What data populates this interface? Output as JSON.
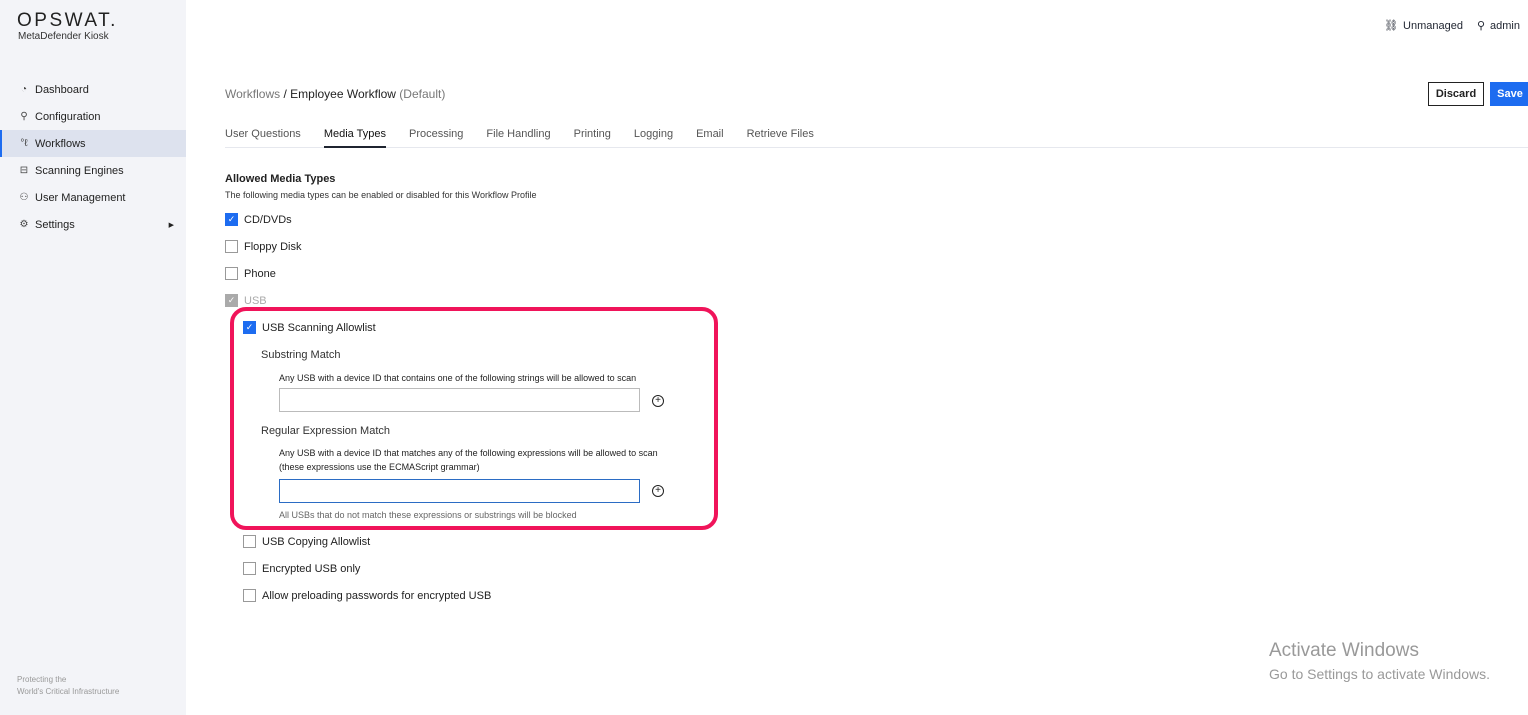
{
  "brand": {
    "logo": "OPSWAT.",
    "product": "MetaDefender Kiosk",
    "footer_line1": "Protecting the",
    "footer_line2": "World's Critical Infrastructure"
  },
  "sidebar": {
    "items": [
      {
        "label": "Dashboard",
        "icon": "gauge-icon"
      },
      {
        "label": "Configuration",
        "icon": "wrench-icon"
      },
      {
        "label": "Workflows",
        "icon": "workflow-icon",
        "active": true
      },
      {
        "label": "Scanning Engines",
        "icon": "engine-icon"
      },
      {
        "label": "User Management",
        "icon": "users-icon"
      },
      {
        "label": "Settings",
        "icon": "gear-icon"
      }
    ]
  },
  "topbar": {
    "status": "Unmanaged",
    "user": "admin"
  },
  "breadcrumb": {
    "root": "Workflows",
    "sep": " / ",
    "current": "Employee Workflow",
    "suffix": " (Default)"
  },
  "actions": {
    "discard": "Discard",
    "save": "Save"
  },
  "tabs": [
    "User Questions",
    "Media Types",
    "Processing",
    "File Handling",
    "Printing",
    "Logging",
    "Email",
    "Retrieve Files"
  ],
  "section": {
    "title": "Allowed Media Types",
    "description": "The following media types can be enabled or disabled for this Workflow Profile"
  },
  "media": {
    "cd": "CD/DVDs",
    "floppy": "Floppy Disk",
    "phone": "Phone",
    "usb": "USB"
  },
  "usb": {
    "scan_allowlist": "USB Scanning Allowlist",
    "substring_title": "Substring Match",
    "substring_desc": "Any USB with a device ID that contains one of the following strings will be allowed to scan",
    "substring_value": "",
    "regex_title": "Regular Expression Match",
    "regex_desc1": "Any USB with a device ID that matches any of the following expressions will be allowed to scan",
    "regex_desc2": "(these expressions use the ECMAScript grammar)",
    "regex_value": "",
    "hint": "All USBs that do not match these expressions or substrings will be blocked",
    "copy_allowlist": "USB Copying Allowlist",
    "encrypted_only": "Encrypted USB only",
    "preload_passwords": "Allow preloading passwords for encrypted USB"
  },
  "watermark": {
    "title": "Activate Windows",
    "subtitle": "Go to Settings to activate Windows."
  }
}
